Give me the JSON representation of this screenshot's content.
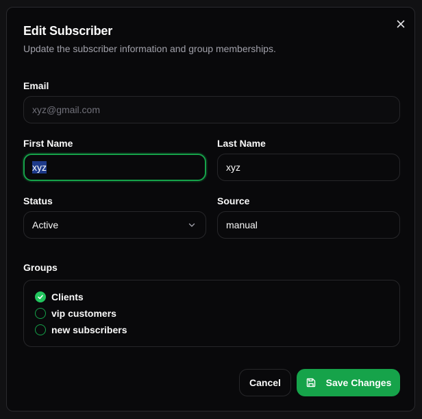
{
  "dialog": {
    "title": "Edit Subscriber",
    "subtitle": "Update the subscriber information and group memberships."
  },
  "form": {
    "email_label": "Email",
    "email_value": "xyz@gmail.com",
    "first_name_label": "First Name",
    "first_name_value": "xyz",
    "last_name_label": "Last Name",
    "last_name_value": "xyz",
    "status_label": "Status",
    "status_value": "Active",
    "source_label": "Source",
    "source_value": "manual"
  },
  "groups": {
    "label": "Groups",
    "items": [
      {
        "label": "Clients",
        "checked": true
      },
      {
        "label": "vip customers",
        "checked": false
      },
      {
        "label": "new subscribers",
        "checked": false
      }
    ]
  },
  "actions": {
    "cancel_label": "Cancel",
    "save_label": "Save Changes"
  },
  "icons": {
    "close": "close-icon",
    "chevron": "chevron-down-icon",
    "save": "save-icon",
    "check": "check-icon"
  },
  "colors": {
    "accent": "#16a34a",
    "background": "#09090b",
    "border": "#27272a",
    "muted_text": "#a1a1aa"
  }
}
